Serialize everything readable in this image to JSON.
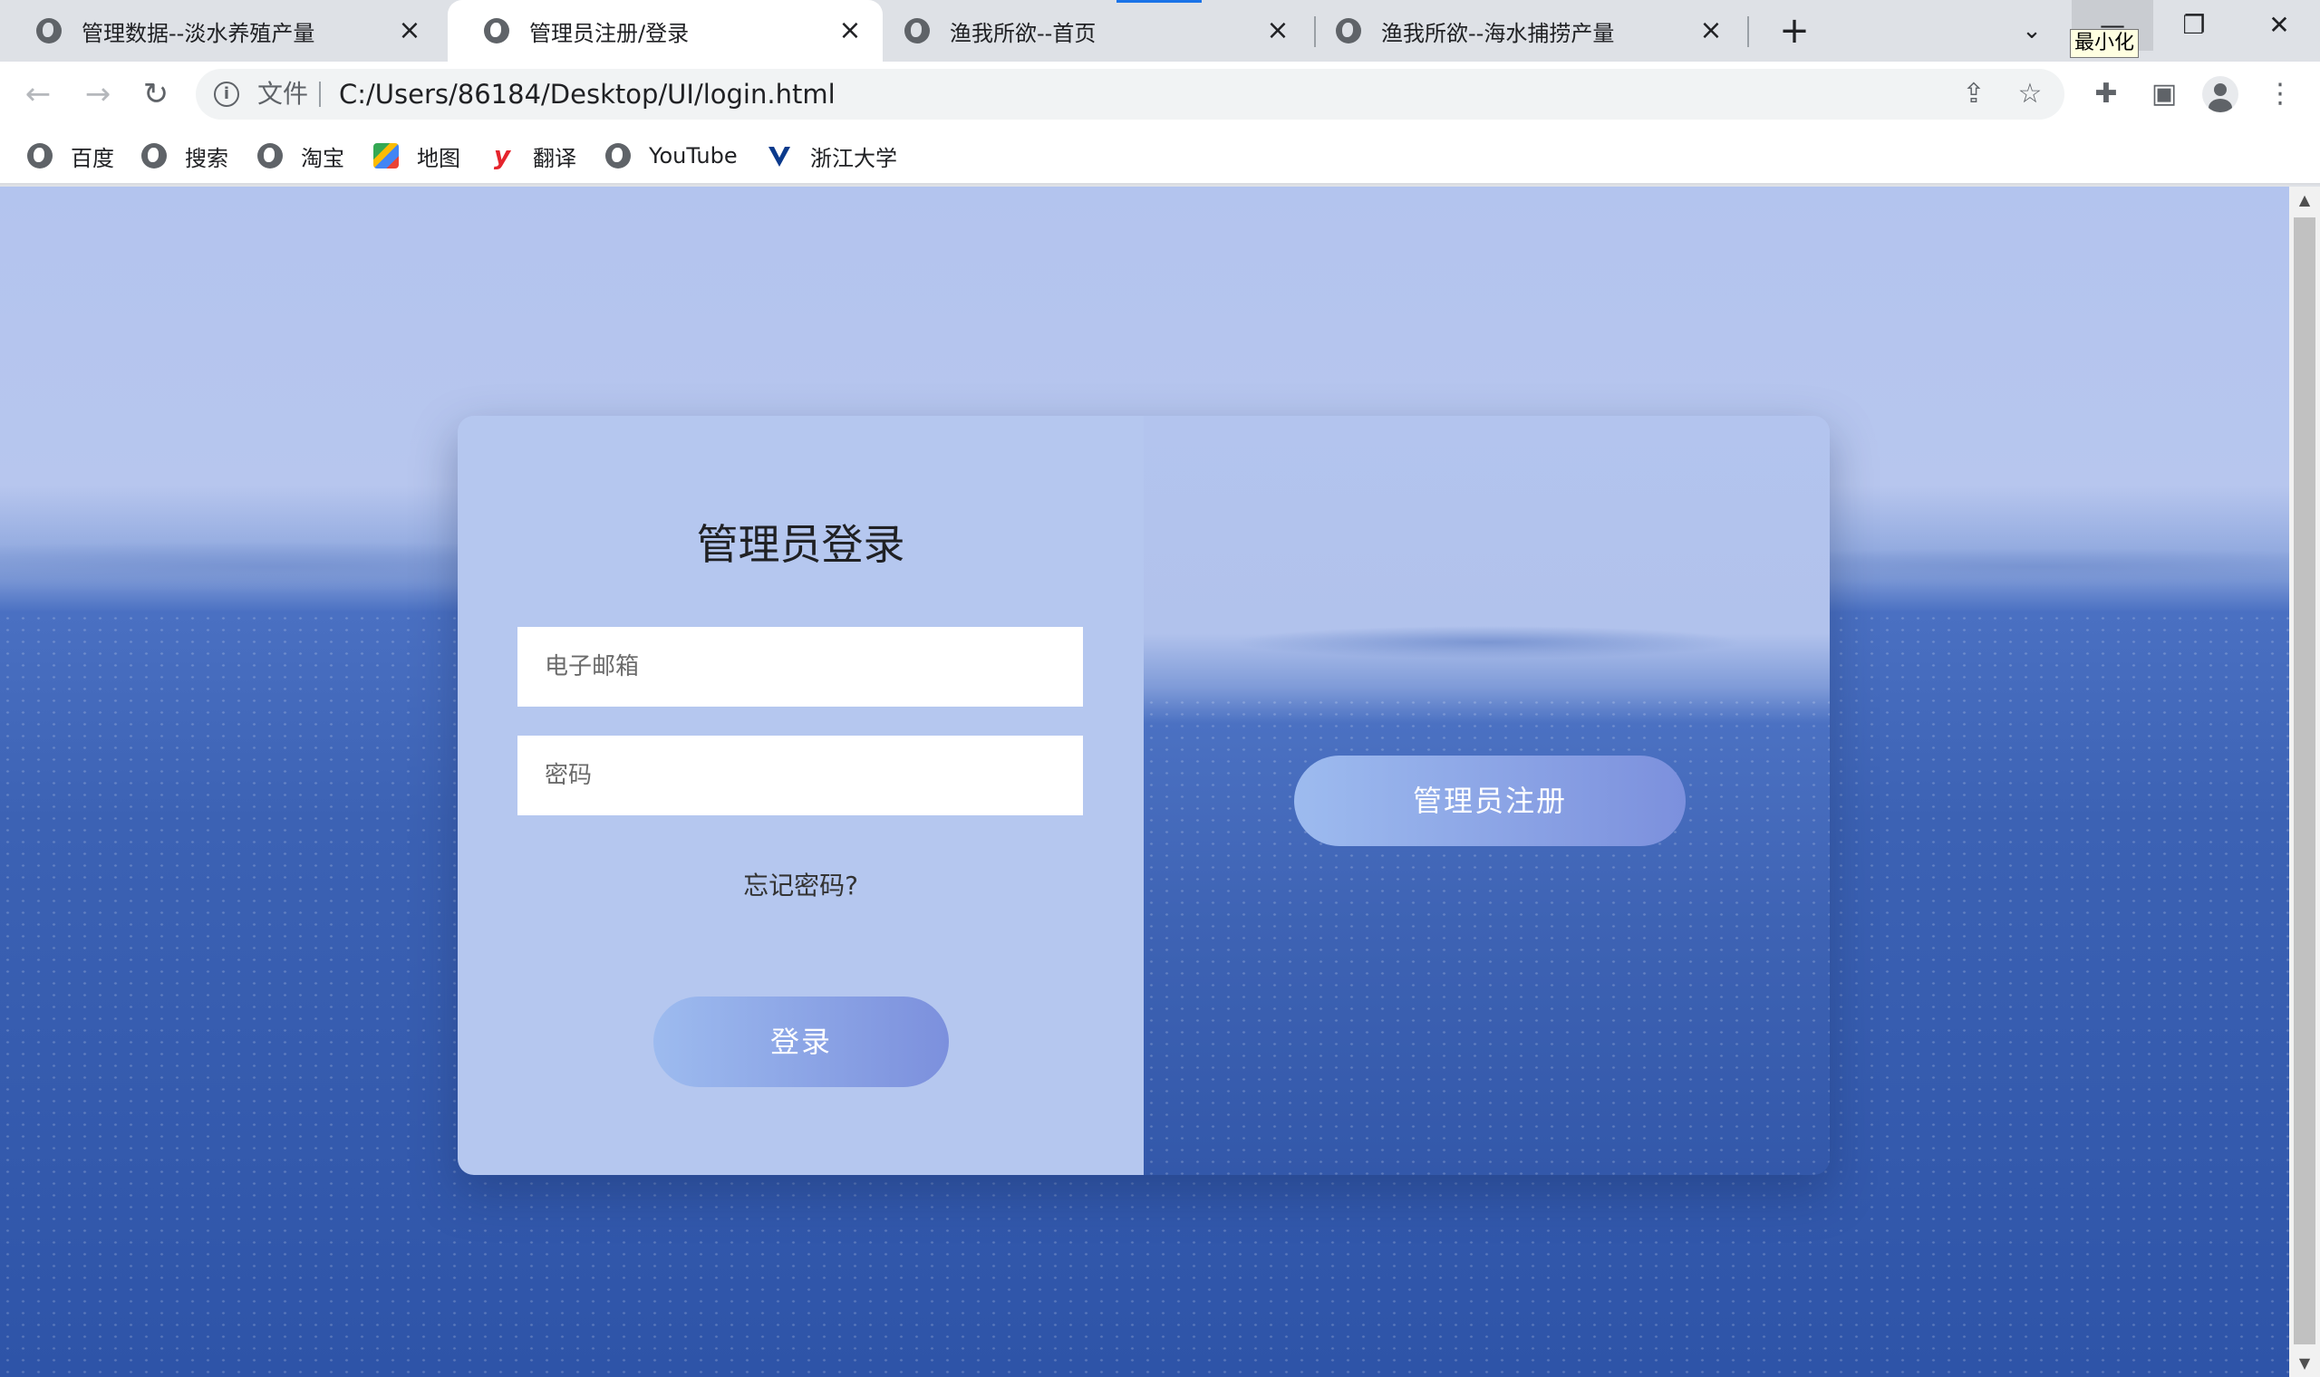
{
  "browser": {
    "tabs": [
      {
        "title": "管理数据--淡水养殖产量",
        "active": false
      },
      {
        "title": "管理员注册/登录",
        "active": true
      },
      {
        "title": "渔我所欲--首页",
        "active": false
      },
      {
        "title": "渔我所欲--海水捕捞产量",
        "active": false
      }
    ],
    "tooltip": "最小化",
    "omnibox": {
      "scheme_label": "文件",
      "url": "C:/Users/86184/Desktop/UI/login.html"
    },
    "bookmarks": [
      {
        "label": "百度",
        "icon": "globe-icon"
      },
      {
        "label": "搜索",
        "icon": "globe-icon"
      },
      {
        "label": "淘宝",
        "icon": "globe-icon"
      },
      {
        "label": "地图",
        "icon": "maps-icon"
      },
      {
        "label": "翻译",
        "icon": "youdao-icon"
      },
      {
        "label": "YouTube",
        "icon": "globe-icon"
      },
      {
        "label": "浙江大学",
        "icon": "zju-icon"
      }
    ]
  },
  "login": {
    "title": "管理员登录",
    "email_placeholder": "电子邮箱",
    "password_placeholder": "密码",
    "forgot_label": "忘记密码?",
    "login_button": "登录"
  },
  "register": {
    "button": "管理员注册"
  },
  "colors": {
    "panel": "#b5c7ef",
    "button_gradient_start": "#9dbbef",
    "button_gradient_end": "#7c90dd",
    "sea": "#3c62b4"
  }
}
